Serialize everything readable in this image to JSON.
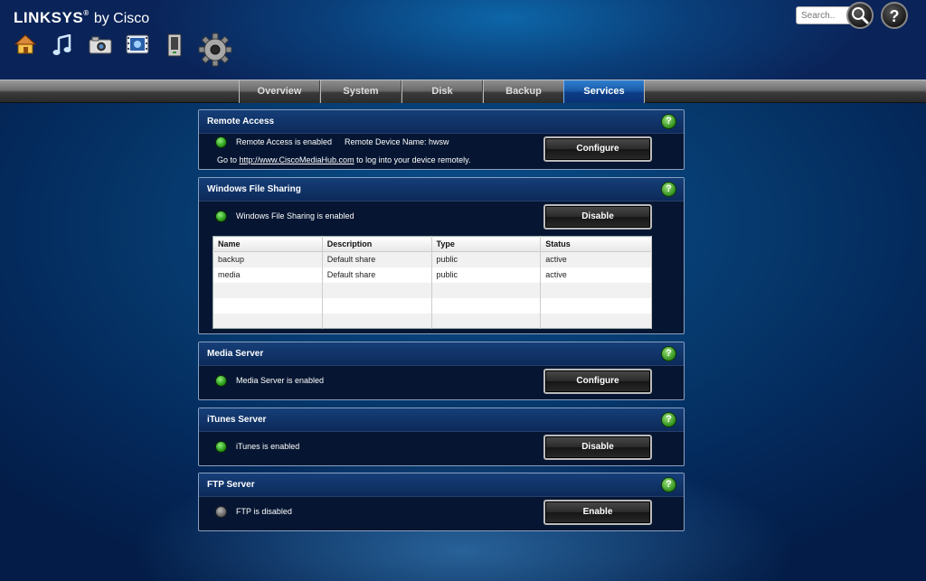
{
  "header": {
    "brand": "LINKSYS",
    "brand_suffix": "by Cisco",
    "search_placeholder": "Search..",
    "apps": [
      {
        "name": "home-icon"
      },
      {
        "name": "music-icon"
      },
      {
        "name": "photos-icon"
      },
      {
        "name": "videos-icon"
      },
      {
        "name": "files-icon"
      },
      {
        "name": "settings-gear-icon"
      }
    ]
  },
  "tabs": [
    {
      "label": "Overview",
      "active": false
    },
    {
      "label": "System",
      "active": false
    },
    {
      "label": "Disk",
      "active": false
    },
    {
      "label": "Backup",
      "active": false
    },
    {
      "label": "Services",
      "active": true
    }
  ],
  "remote_access": {
    "title": "Remote Access",
    "status": "Remote Access is enabled",
    "device_name": "Remote Device Name: hwsw",
    "goto_prefix": "Go to ",
    "link": "http://www.CiscoMediaHub.com",
    "goto_suffix": " to log into your device remotely.",
    "button": "Configure",
    "enabled": true
  },
  "windows_sharing": {
    "title": "Windows File Sharing",
    "status": "Windows File Sharing is enabled",
    "button": "Disable",
    "enabled": true,
    "columns": [
      "Name",
      "Description",
      "Type",
      "Status"
    ],
    "rows": [
      [
        "backup",
        "Default share",
        "public",
        "active"
      ],
      [
        "media",
        "Default share",
        "public",
        "active"
      ]
    ]
  },
  "media_server": {
    "title": "Media Server",
    "status": "Media Server is enabled",
    "button": "Configure",
    "enabled": true
  },
  "itunes_server": {
    "title": "iTunes Server",
    "status": "iTunes is enabled",
    "button": "Disable",
    "enabled": true
  },
  "ftp_server": {
    "title": "FTP Server",
    "status": "FTP is disabled",
    "button": "Enable",
    "enabled": false
  },
  "help_glyph": "?",
  "colors": {
    "accent": "#1a5ca8",
    "status_on": "#2b9a1a",
    "status_off": "#6a6a6a",
    "help": "#2f8f1a"
  }
}
